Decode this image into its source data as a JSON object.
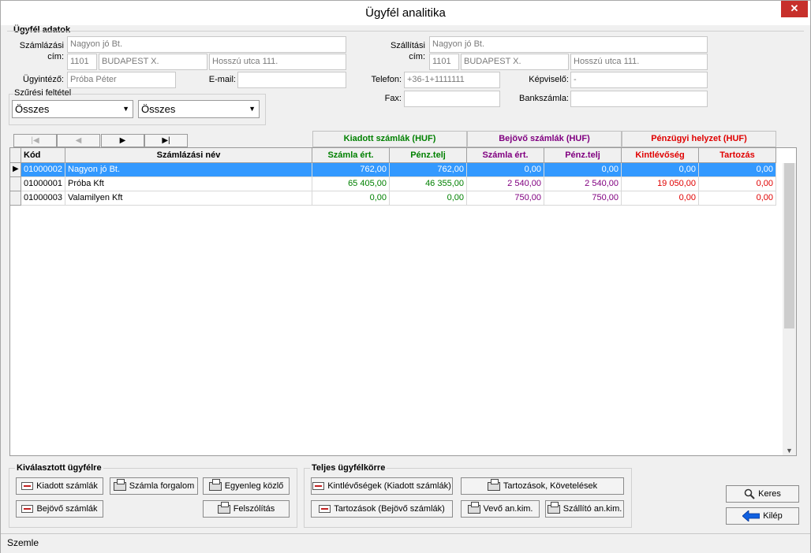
{
  "window": {
    "title": "Ügyfél analitika",
    "close": "✕"
  },
  "customer": {
    "section_title": "Ügyfél adatok",
    "billing_label_1": "Számlázási",
    "billing_label_2": "cím:",
    "billing_name": "Nagyon jó Bt.",
    "billing_zip": "1101",
    "billing_city": "BUDAPEST X.",
    "billing_street": "Hosszú utca 111.",
    "agent_label": "Ügyintéző:",
    "agent": "Próba Péter",
    "email_label": "E-mail:",
    "email": "",
    "shipping_label_1": "Szállítási",
    "shipping_label_2": "cím:",
    "shipping_name": "Nagyon jó Bt.",
    "shipping_zip": "1101",
    "shipping_city": "BUDAPEST X.",
    "shipping_street": "Hosszú utca 111.",
    "phone_label": "Telefon:",
    "phone": "+36-1+1111111",
    "rep_label": "Képviselő:",
    "rep": "-",
    "fax_label": "Fax:",
    "fax": "",
    "bank_label": "Bankszámla:",
    "bank": ""
  },
  "filter": {
    "title": "Szűrési feltétel",
    "select1": "Összes",
    "select2": "Összes"
  },
  "nav": {
    "first": "|◀",
    "prev": "◀",
    "next": "▶",
    "last": "▶|"
  },
  "groups": {
    "issued": "Kiadott számlák (HUF)",
    "incoming": "Bejövő számlák (HUF)",
    "financial": "Pénzügyi helyzet (HUF)"
  },
  "colors": {
    "issued": "#008000",
    "incoming": "#800080",
    "financial": "#e00000",
    "selected": "#3399ff"
  },
  "columns": [
    "Kód",
    "Számlázási név",
    "Számla ért.",
    "Pénz.telj",
    "Számla ért.",
    "Pénz.telj",
    "Kintlévőség",
    "Tartozás"
  ],
  "rows": [
    {
      "code": "01000002",
      "name": "Nagyon jó Bt.",
      "v1": "762,00",
      "v2": "762,00",
      "v3": "0,00",
      "v4": "0,00",
      "v5": "0,00",
      "v6": "0,00"
    },
    {
      "code": "01000001",
      "name": "Próba Kft",
      "v1": "65 405,00",
      "v2": "46 355,00",
      "v3": "2 540,00",
      "v4": "2 540,00",
      "v5": "19 050,00",
      "v6": "0,00"
    },
    {
      "code": "01000003",
      "name": "Valamilyen Kft",
      "v1": "0,00",
      "v2": "0,00",
      "v3": "750,00",
      "v4": "750,00",
      "v5": "0,00",
      "v6": "0,00"
    }
  ],
  "selected_section": {
    "title": "Kiválasztott ügyfélre",
    "issued": "Kiadott számlák",
    "incoming": "Bejövő számlák",
    "turnover": "Számla forgalom",
    "balance": "Egyenleg közlő",
    "reminder": "Felszólítás"
  },
  "all_section": {
    "title": "Teljes ügyfélkörre",
    "receivables": "Kintlévőségek (Kiadott számlák)",
    "debts": "Tartozások (Bejövő számlák)",
    "debts_claims": "Tartozások, Követelések",
    "customer_card": "Vevő an.kim.",
    "supplier_card": "Szállító an.kim."
  },
  "actions": {
    "search": "Keres",
    "exit": "Kilép"
  },
  "status": "Szemle"
}
